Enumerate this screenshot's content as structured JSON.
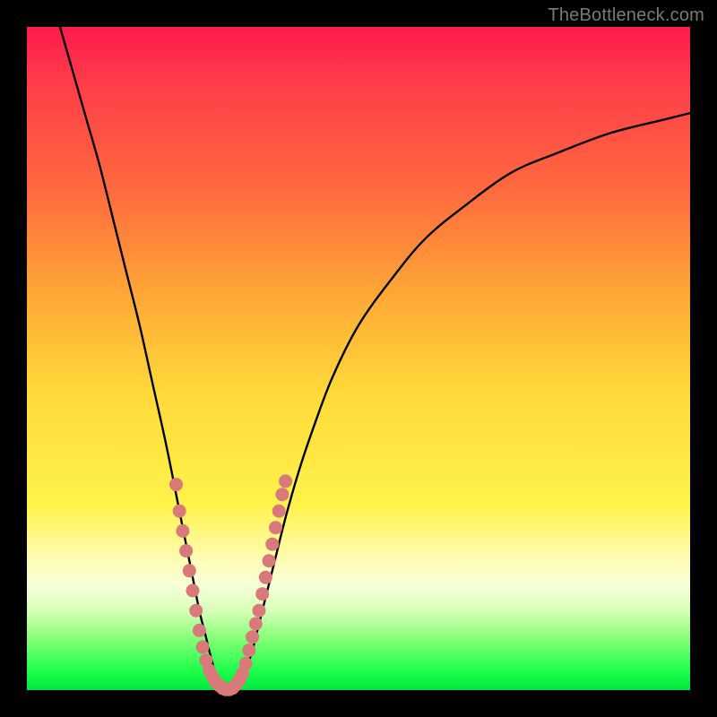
{
  "watermark": "TheBottleneck.com",
  "colors": {
    "background": "#000000",
    "curve": "#000000",
    "dot": "#d87a7a",
    "gradient_stops": [
      "#ff1a4d",
      "#ff6b3e",
      "#ffd93a",
      "#fffcb0",
      "#1eff4a"
    ]
  },
  "chart_data": {
    "type": "line",
    "title": "",
    "xlabel": "",
    "ylabel": "",
    "xlim": [
      0,
      100
    ],
    "ylim": [
      0,
      100
    ],
    "curve": {
      "x": [
        5,
        7,
        9,
        11,
        13,
        15,
        17,
        19,
        21,
        23,
        24,
        25,
        26,
        27,
        28,
        29,
        30,
        31,
        32,
        33,
        34,
        35,
        37,
        39,
        41,
        43,
        46,
        50,
        55,
        60,
        66,
        73,
        80,
        88,
        96,
        100
      ],
      "y": [
        100,
        93,
        86,
        79,
        71,
        63,
        55,
        46,
        37,
        27,
        22,
        17,
        12,
        8,
        4,
        1,
        0,
        0,
        1,
        3,
        6,
        10,
        18,
        26,
        33,
        39,
        47,
        55,
        62,
        68,
        73,
        78,
        81,
        84,
        86,
        87
      ]
    },
    "dots": [
      {
        "x": 22.5,
        "y": 31
      },
      {
        "x": 23.0,
        "y": 27
      },
      {
        "x": 23.5,
        "y": 24
      },
      {
        "x": 24.0,
        "y": 21
      },
      {
        "x": 24.5,
        "y": 18
      },
      {
        "x": 25.0,
        "y": 15
      },
      {
        "x": 25.5,
        "y": 12
      },
      {
        "x": 26.0,
        "y": 9
      },
      {
        "x": 26.5,
        "y": 6.5
      },
      {
        "x": 27.0,
        "y": 4.5
      },
      {
        "x": 27.5,
        "y": 3
      },
      {
        "x": 28.0,
        "y": 2
      },
      {
        "x": 28.5,
        "y": 1.2
      },
      {
        "x": 29.0,
        "y": 0.7
      },
      {
        "x": 29.5,
        "y": 0.3
      },
      {
        "x": 30.0,
        "y": 0.1
      },
      {
        "x": 30.5,
        "y": 0.1
      },
      {
        "x": 31.0,
        "y": 0.3
      },
      {
        "x": 31.5,
        "y": 0.8
      },
      {
        "x": 32.0,
        "y": 1.5
      },
      {
        "x": 32.5,
        "y": 2.5
      },
      {
        "x": 33.0,
        "y": 4
      },
      {
        "x": 33.5,
        "y": 6
      },
      {
        "x": 34.0,
        "y": 8
      },
      {
        "x": 34.5,
        "y": 10
      },
      {
        "x": 35.0,
        "y": 12
      },
      {
        "x": 35.5,
        "y": 14.5
      },
      {
        "x": 36.0,
        "y": 17
      },
      {
        "x": 36.5,
        "y": 19.5
      },
      {
        "x": 37.0,
        "y": 22
      },
      {
        "x": 37.5,
        "y": 24.5
      },
      {
        "x": 38.0,
        "y": 27
      },
      {
        "x": 38.5,
        "y": 29.5
      },
      {
        "x": 39.0,
        "y": 31.5
      }
    ]
  }
}
